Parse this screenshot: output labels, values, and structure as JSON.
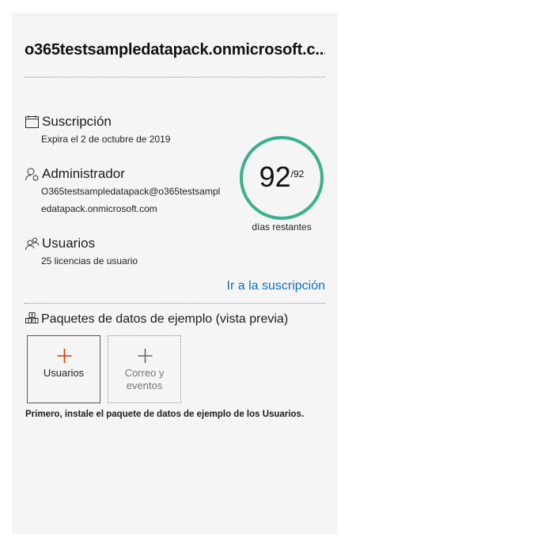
{
  "tenant": {
    "title": "o365testsampledatapack.onmicrosoft.c..."
  },
  "subscription": {
    "label": "Suscripción",
    "detail": "Expira el 2 de octubre de 2019",
    "icon": "calendar-icon"
  },
  "admin": {
    "label": "Administrador",
    "email": "O365testsampledatapack@o365testsampledatapack.onmicrosoft.com",
    "icon": "admin-person-icon"
  },
  "users": {
    "label": "Usuarios",
    "detail": "25 licencias de usuario",
    "icon": "users-icon"
  },
  "days": {
    "remaining": "92",
    "total": "/92",
    "caption": "días restantes",
    "fraction": 1.0,
    "color": "#3bb08f"
  },
  "link": {
    "label": "Ir a la suscripción",
    "color": "#106ebe"
  },
  "packs": {
    "title": "Paquetes de datos de ejemplo (vista previa)",
    "icon": "packages-icon",
    "tiles": [
      {
        "label": "Usuarios",
        "plus_color": "#d83b01",
        "enabled": true
      },
      {
        "label": "Correo y eventos",
        "plus_color": "#666666",
        "enabled": false
      }
    ],
    "hint_prefix": "Primero, instale el paquete de datos de ejemplo de los ",
    "hint_bold": "Usuarios",
    "hint_suffix": "."
  }
}
